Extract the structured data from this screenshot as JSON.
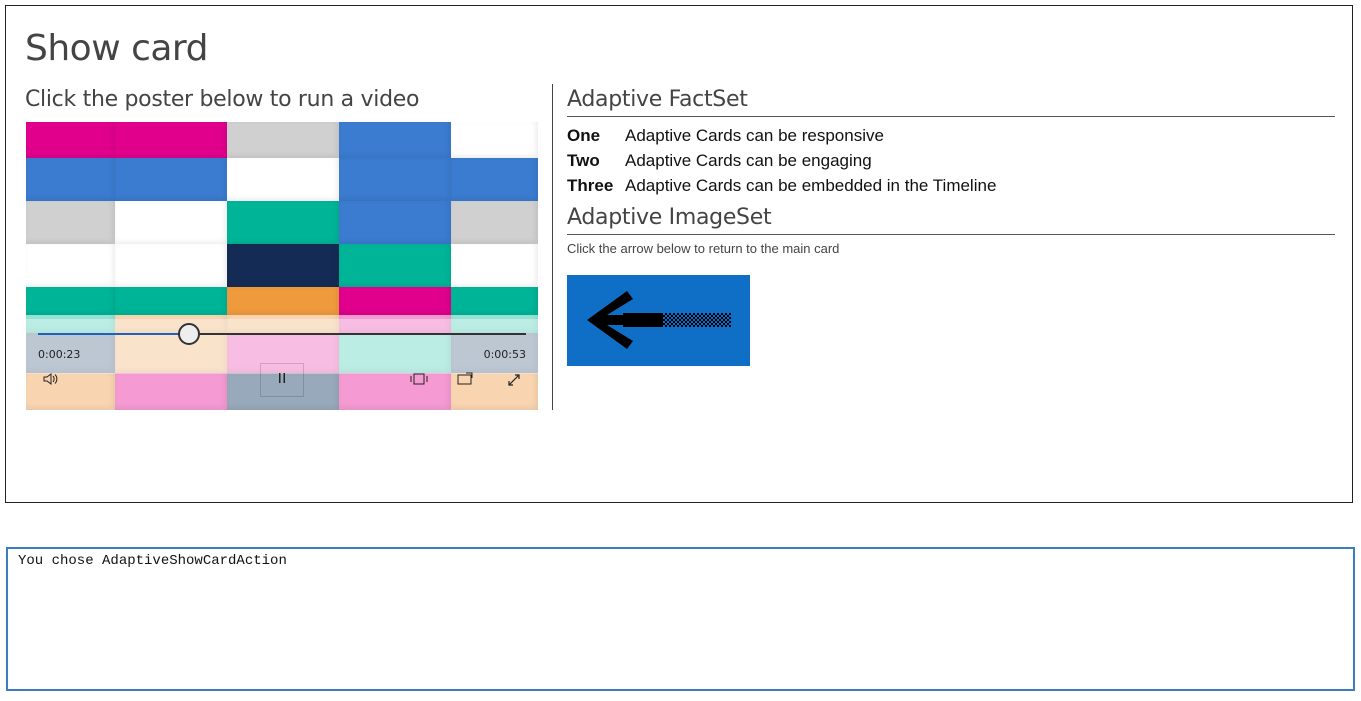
{
  "card": {
    "title": "Show card",
    "left": {
      "subtitle": "Click the poster below to run a video",
      "video": {
        "current_time": "0:00:23",
        "duration": "0:00:53",
        "progress_fraction": 0.31,
        "controls": {
          "volume": "volume-icon",
          "play_pause": "pause-icon",
          "captions": "captions-icon",
          "cast": "cast-icon",
          "fullscreen": "fullscreen-icon"
        },
        "mosaic_colors": {
          "magenta": "#e0008c",
          "blue": "#3b7bd0",
          "gray": "#d0d0d0",
          "white": "#ffffff",
          "teal": "#00b497",
          "navy": "#142c55",
          "orange": "#f09a3e",
          "peach": "#f8d5b0",
          "pink": "#f59ad3",
          "mint": "#97e3d6",
          "slate": "#98a9bb"
        }
      }
    },
    "right": {
      "factset_title": "Adaptive FactSet",
      "facts": [
        {
          "key": "One",
          "value": "Adaptive Cards can be responsive"
        },
        {
          "key": "Two",
          "value": "Adaptive Cards can be engaging"
        },
        {
          "key": "Three",
          "value": "Adaptive Cards can be embedded in the Timeline"
        }
      ],
      "imageset_title": "Adaptive ImageSet",
      "imageset_note": "Click the arrow below to return to the main card",
      "arrow_image": {
        "icon": "left-arrow-icon",
        "background": "#0f6fc6"
      }
    }
  },
  "output": {
    "text": "You chose AdaptiveShowCardAction"
  }
}
